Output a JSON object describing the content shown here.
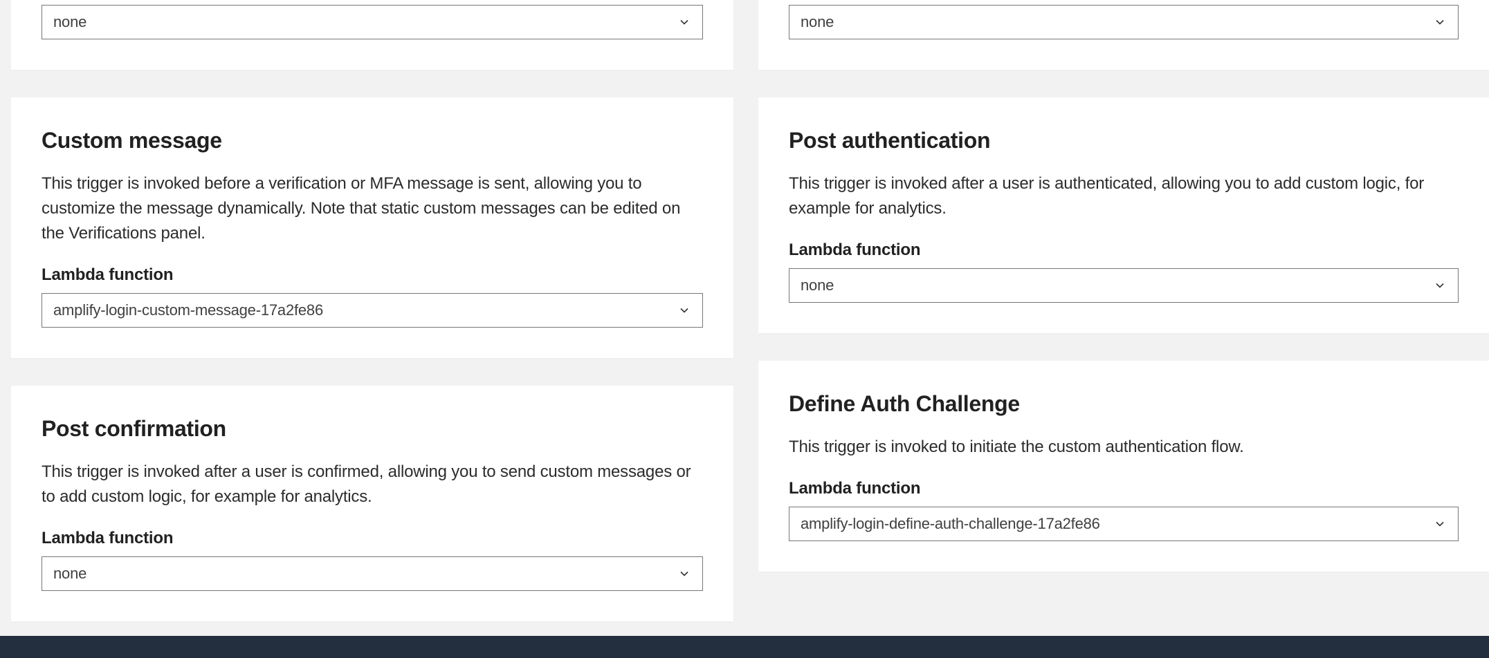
{
  "left": {
    "partial_top": {
      "select_value": "none"
    },
    "custom_message": {
      "title": "Custom message",
      "desc": "This trigger is invoked before a verification or MFA message is sent, allowing you to customize the message dynamically. Note that static custom messages can be edited on the Verifications panel.",
      "field_label": "Lambda function",
      "select_value": "amplify-login-custom-message-17a2fe86"
    },
    "post_confirmation": {
      "title": "Post confirmation",
      "desc": "This trigger is invoked after a user is confirmed, allowing you to send custom messages or to add custom logic, for example for analytics.",
      "field_label": "Lambda function",
      "select_value": "none"
    }
  },
  "right": {
    "partial_top": {
      "select_value": "none"
    },
    "post_authentication": {
      "title": "Post authentication",
      "desc": "This trigger is invoked after a user is authenticated, allowing you to add custom logic, for example for analytics.",
      "field_label": "Lambda function",
      "select_value": "none"
    },
    "define_auth_challenge": {
      "title": "Define Auth Challenge",
      "desc": "This trigger is invoked to initiate the custom authentication flow.",
      "field_label": "Lambda function",
      "select_value": "amplify-login-define-auth-challenge-17a2fe86"
    }
  }
}
